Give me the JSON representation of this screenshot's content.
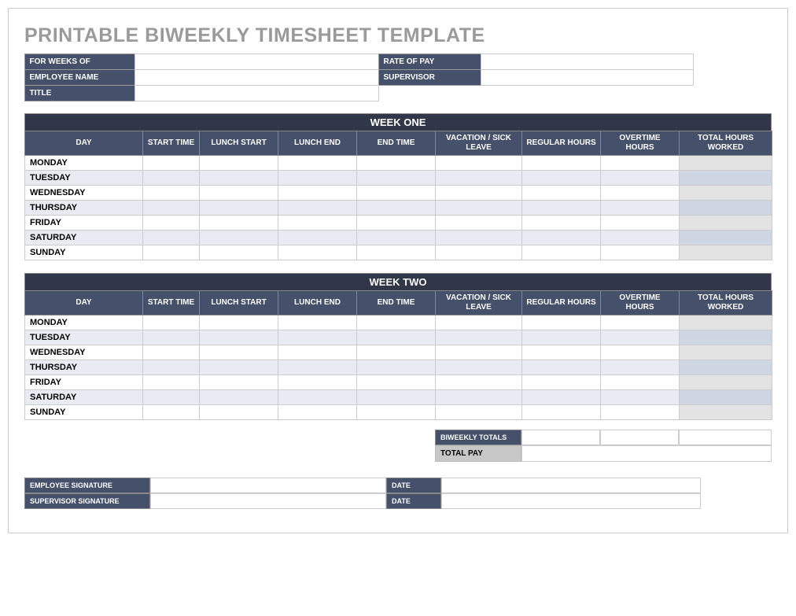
{
  "title": "PRINTABLE BIWEEKLY TIMESHEET TEMPLATE",
  "header": {
    "for_weeks_of_label": "FOR WEEKS OF",
    "for_weeks_of": "",
    "rate_of_pay_label": "RATE OF PAY",
    "rate_of_pay": "",
    "employee_name_label": "EMPLOYEE NAME",
    "employee_name": "",
    "supervisor_label": "SUPERVISOR",
    "supervisor": "",
    "title_label": "TITLE",
    "title": ""
  },
  "columns": {
    "day": "DAY",
    "start_time": "START TIME",
    "lunch_start": "LUNCH START",
    "lunch_end": "LUNCH END",
    "end_time": "END TIME",
    "vacation": "VACATION / SICK LEAVE",
    "regular": "REGULAR HOURS",
    "overtime": "OVERTIME HOURS",
    "total": "TOTAL HOURS WORKED"
  },
  "week1": {
    "title": "WEEK ONE",
    "days": [
      "MONDAY",
      "TUESDAY",
      "WEDNESDAY",
      "THURSDAY",
      "FRIDAY",
      "SATURDAY",
      "SUNDAY"
    ]
  },
  "week2": {
    "title": "WEEK TWO",
    "days": [
      "MONDAY",
      "TUESDAY",
      "WEDNESDAY",
      "THURSDAY",
      "FRIDAY",
      "SATURDAY",
      "SUNDAY"
    ]
  },
  "totals": {
    "biweekly_label": "BIWEEKLY TOTALS",
    "regular_total": "",
    "overtime_total": "",
    "hours_total": "",
    "total_pay_label": "TOTAL PAY",
    "total_pay": ""
  },
  "signatures": {
    "employee_label": "EMPLOYEE SIGNATURE",
    "employee": "",
    "supervisor_label": "SUPERVISOR SIGNATURE",
    "supervisor": "",
    "date_label": "DATE",
    "employee_date": "",
    "supervisor_date": ""
  }
}
